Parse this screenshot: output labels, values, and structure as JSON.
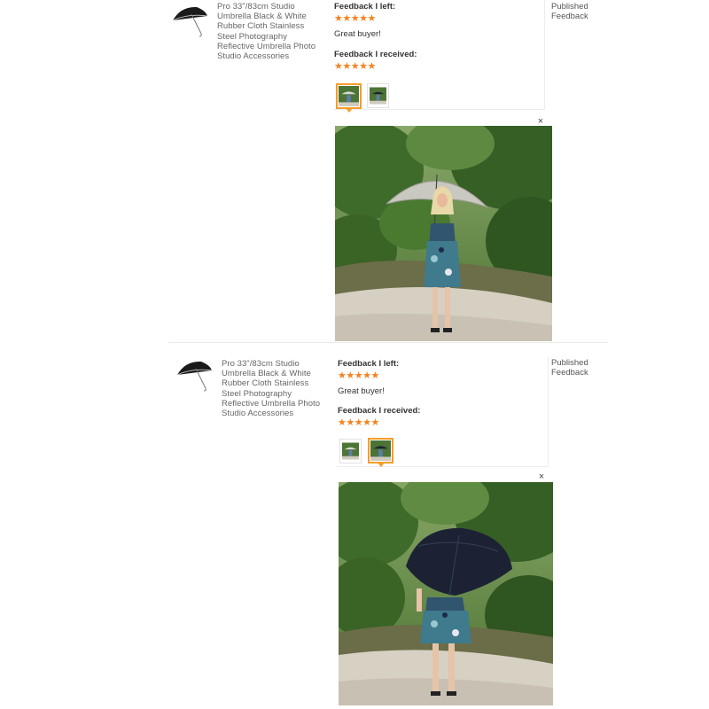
{
  "entries": [
    {
      "product_title": "Pro 33\"/83cm Studio Umbrella Black & White Rubber Cloth Stainless Steel Photography Reflective Umbrella Photo Studio Accessories",
      "feedback_left_label": "Feedback I left:",
      "feedback_left_stars": "★★★★★",
      "feedback_left_comment": "Great buyer!",
      "feedback_received_label": "Feedback I received:",
      "feedback_received_stars": "★★★★★",
      "status": "Published Feedback",
      "close_glyph": "×",
      "selected_photo_index": 0,
      "photo_subject": "woman-with-white-umbrella"
    },
    {
      "product_title": "Pro 33\"/83cm Studio Umbrella Black & White Rubber Cloth Stainless Steel Photography Reflective Umbrella Photo Studio Accessories",
      "feedback_left_label": "Feedback I left:",
      "feedback_left_stars": "★★★★★",
      "feedback_left_comment": "Great buyer!",
      "feedback_received_label": "Feedback I received:",
      "feedback_received_stars": "★★★★★",
      "status": "Published Feedback",
      "close_glyph": "×",
      "selected_photo_index": 1,
      "photo_subject": "woman-with-black-umbrella"
    }
  ],
  "colors": {
    "star": "#f5821f",
    "selected_border": "#f59d2a",
    "foliage": "#4f7a33",
    "path": "#d9d4c8"
  }
}
